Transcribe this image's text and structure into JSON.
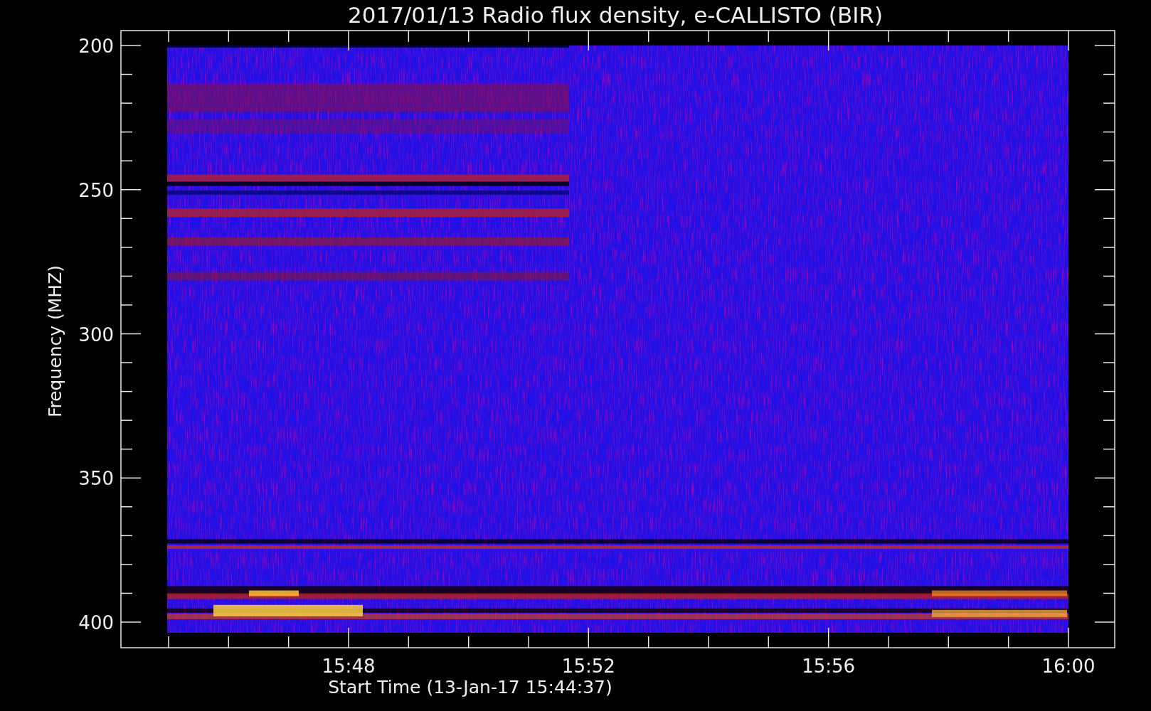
{
  "title": "2017/01/13  Radio flux density, e-CALLISTO (BIR)",
  "y_axis": {
    "label": "Frequency (MHZ)",
    "ticks": [
      "200",
      "250",
      "300",
      "350",
      "400"
    ]
  },
  "x_axis": {
    "label": "Start Time (13-Jan-17 15:44:37)",
    "ticks": [
      "15:48",
      "15:52",
      "15:56",
      "16:00"
    ]
  }
}
